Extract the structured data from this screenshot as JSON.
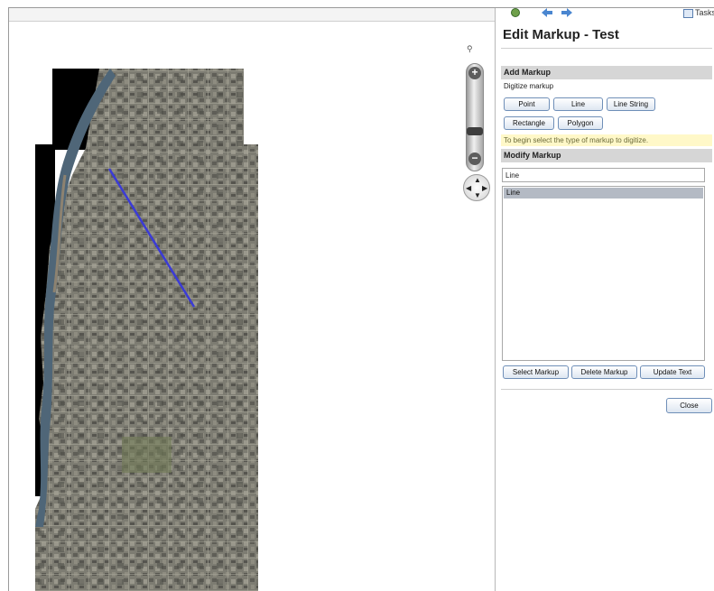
{
  "panel": {
    "title": "Edit Markup - Test",
    "tasks_label": "Tasks",
    "add_markup": {
      "header": "Add Markup",
      "digitize_label": "Digitize markup",
      "buttons": [
        "Point",
        "Line",
        "Line String",
        "Rectangle",
        "Polygon"
      ],
      "hint": "To begin select the type of markup to digitize."
    },
    "modify_markup": {
      "header": "Modify Markup",
      "text_value": "Line",
      "list_items": [
        "Line"
      ],
      "buttons": [
        "Select Markup",
        "Delete Markup",
        "Update Text"
      ]
    },
    "close_label": "Close"
  },
  "map": {
    "zoom_in_symbol": "+",
    "zoom_out_symbol": "−",
    "pan_arrows": [
      "▲",
      "▼",
      "◀",
      "▶"
    ],
    "magnifier_symbol": "⚲",
    "colors": {
      "markup_line": "#3b3bd6",
      "water": "#4f6678",
      "background_black": "#000000",
      "imagery_base": "#7c7c70"
    }
  }
}
